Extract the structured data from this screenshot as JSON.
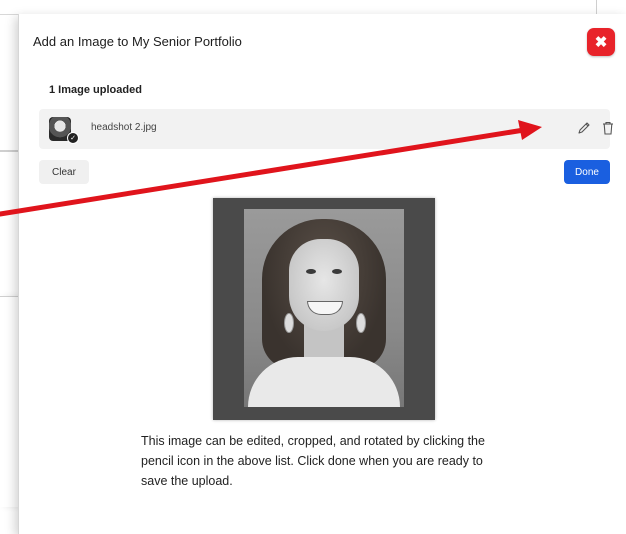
{
  "modal": {
    "title": "Add an Image to My Senior Portfolio",
    "close_icon": "close-icon",
    "uploaded_count": "1 Image uploaded",
    "file": {
      "name": "headshot 2.jpg",
      "edit_icon": "pencil-icon",
      "delete_icon": "trash-icon"
    },
    "clear_label": "Clear",
    "done_label": "Done",
    "caption": "This image can be edited, cropped, and rotated by clicking the pencil icon in the above list. Click done when you are ready to save the upload."
  },
  "colors": {
    "close_button": "#e8232a",
    "done_button": "#1a5fe0",
    "annotation_arrow": "#e0141c"
  }
}
